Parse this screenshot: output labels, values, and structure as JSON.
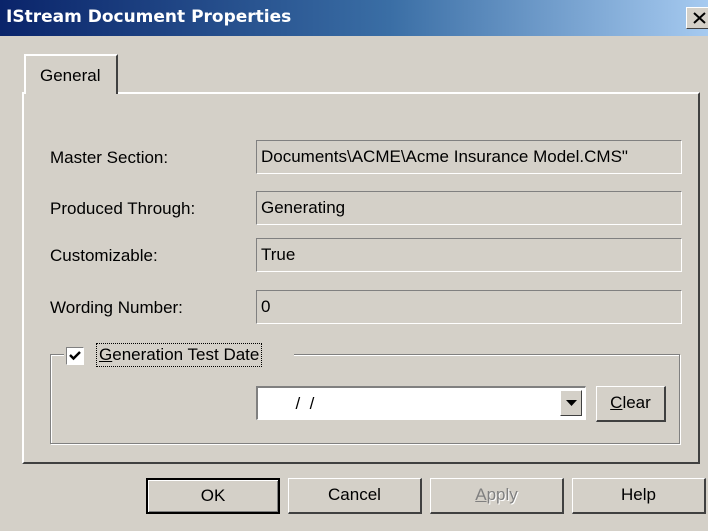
{
  "window": {
    "title": "IStream Document Properties"
  },
  "tabs": [
    {
      "label": "General"
    }
  ],
  "fields": [
    {
      "label": "Master Section:",
      "value": "Documents\\ACME\\Acme Insurance Model.CMS\""
    },
    {
      "label": "Produced Through:",
      "value": "Generating"
    },
    {
      "label": "Customizable:",
      "value": "True"
    },
    {
      "label": "Wording Number:",
      "value": "0"
    }
  ],
  "generation_test_date": {
    "checked": true,
    "label_mnemonic": "G",
    "label_rest": "eneration Test Date",
    "value": "  /  /",
    "clear_mnemonic": "C",
    "clear_rest": "lear"
  },
  "buttons": {
    "ok": "OK",
    "cancel": "Cancel",
    "apply_mnemonic": "A",
    "apply_rest": "pply",
    "help": "Help"
  },
  "icons": {
    "close": "close-icon",
    "check": "checkmark-icon",
    "dropdown": "chevron-down-icon"
  }
}
